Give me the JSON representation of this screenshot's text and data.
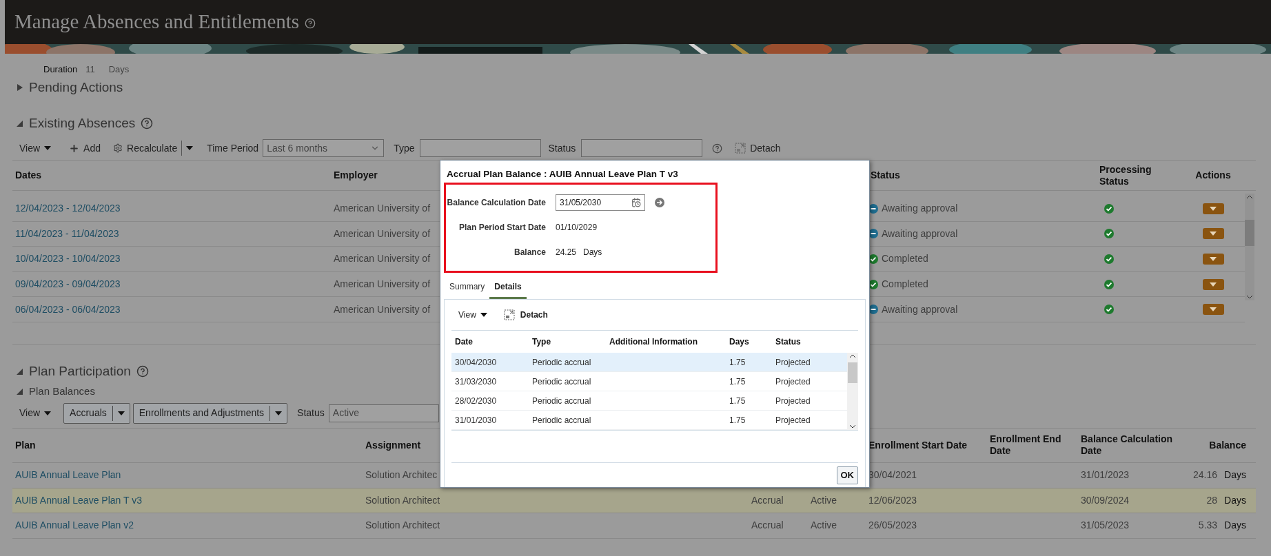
{
  "page": {
    "title": "Manage Absences and Entitlements"
  },
  "duration": {
    "label": "Duration",
    "value": "11",
    "unit": "Days"
  },
  "pending_actions": {
    "title": "Pending Actions",
    "expanded": false
  },
  "existing_absences": {
    "title": "Existing Absences",
    "expanded": true,
    "toolbar": {
      "view": "View",
      "add": "Add",
      "recalculate": "Recalculate",
      "time_period": {
        "label": "Time Period",
        "value": "Last 6 months"
      },
      "type": {
        "label": "Type"
      },
      "status": {
        "label": "Status"
      },
      "detach": "Detach"
    },
    "columns": [
      "Dates",
      "Employer",
      "Status",
      "Processing Status",
      "Actions"
    ],
    "rows": [
      {
        "dates": "12/04/2023 - 12/04/2023",
        "employer": "American University of",
        "status": "Awaiting approval",
        "kind": "pending"
      },
      {
        "dates": "11/04/2023 - 11/04/2023",
        "employer": "American University of",
        "status": "Awaiting approval",
        "kind": "pending"
      },
      {
        "dates": "10/04/2023 - 10/04/2023",
        "employer": "American University of",
        "status": "Completed",
        "kind": "completed"
      },
      {
        "dates": "09/04/2023 - 09/04/2023",
        "employer": "American University of",
        "status": "Completed",
        "kind": "completed"
      },
      {
        "dates": "06/04/2023 - 06/04/2023",
        "employer": "American University of",
        "status": "Awaiting approval",
        "kind": "pending"
      }
    ]
  },
  "plan_participation": {
    "title": "Plan Participation",
    "expanded": true,
    "plan_balances": {
      "title": "Plan Balances",
      "expanded": true
    },
    "toolbar": {
      "view": "View",
      "buttons": [
        "Accruals",
        "Enrollments and Adjustments"
      ],
      "status": {
        "label": "Status",
        "value": "Active"
      }
    },
    "columns": {
      "plan": "Plan",
      "assignment": "Assignment",
      "enrollment_start": "Enrollment Start Date",
      "enrollment_end": "Enrollment End Date",
      "balance_date": "Balance Calculation Date",
      "balance": "Balance"
    },
    "rows": [
      {
        "plan": "AUIB Annual Leave Plan",
        "assignment": "Solution Architec",
        "enrollment_start": "30/04/2021",
        "balance_date": "31/01/2023",
        "balance": "24.16",
        "unit": "Days",
        "selected": false
      },
      {
        "plan": "AUIB Annual Leave Plan T v3",
        "assignment": "Solution Architect",
        "column_3": "Accrual",
        "column_4": "Active",
        "enrollment_start": "12/06/2023",
        "balance_date": "30/09/2024",
        "balance": "28",
        "unit": "Days",
        "selected": true
      },
      {
        "plan": "AUIB Annual Leave Plan v2",
        "assignment": "Solution Architect",
        "column_3": "Accrual",
        "column_4": "Active",
        "enrollment_start": "26/05/2023",
        "balance_date": "31/05/2023",
        "balance": "5.33",
        "unit": "Days",
        "selected": false
      }
    ]
  },
  "dialog": {
    "title": "Accrual Plan Balance : AUIB Annual Leave Plan T v3",
    "fields": [
      {
        "label": "Balance Calculation Date",
        "kind": "date",
        "value": "31/05/2030"
      },
      {
        "label": "Plan Period Start Date",
        "kind": "text",
        "value": "01/10/2029"
      },
      {
        "label": "Balance",
        "kind": "text",
        "value": "24.25",
        "unit": "Days"
      }
    ],
    "tabs": [
      {
        "label": "Summary",
        "selected": false
      },
      {
        "label": "Details",
        "selected": true
      }
    ],
    "toolbar": {
      "view": "View",
      "detach": "Detach"
    },
    "columns": [
      "Date",
      "Type",
      "Additional Information",
      "Days",
      "Status"
    ],
    "rows": [
      {
        "date": "30/04/2030",
        "type": "Periodic accrual",
        "days": "1.75",
        "status": "Projected",
        "selected": true
      },
      {
        "date": "31/03/2030",
        "type": "Periodic accrual",
        "days": "1.75",
        "status": "Projected",
        "selected": false
      },
      {
        "date": "28/02/2030",
        "type": "Periodic accrual",
        "days": "1.75",
        "status": "Projected",
        "selected": false
      },
      {
        "date": "31/01/2030",
        "type": "Periodic accrual",
        "days": "1.75",
        "status": "Projected",
        "selected": false
      }
    ],
    "ok": "OK"
  }
}
